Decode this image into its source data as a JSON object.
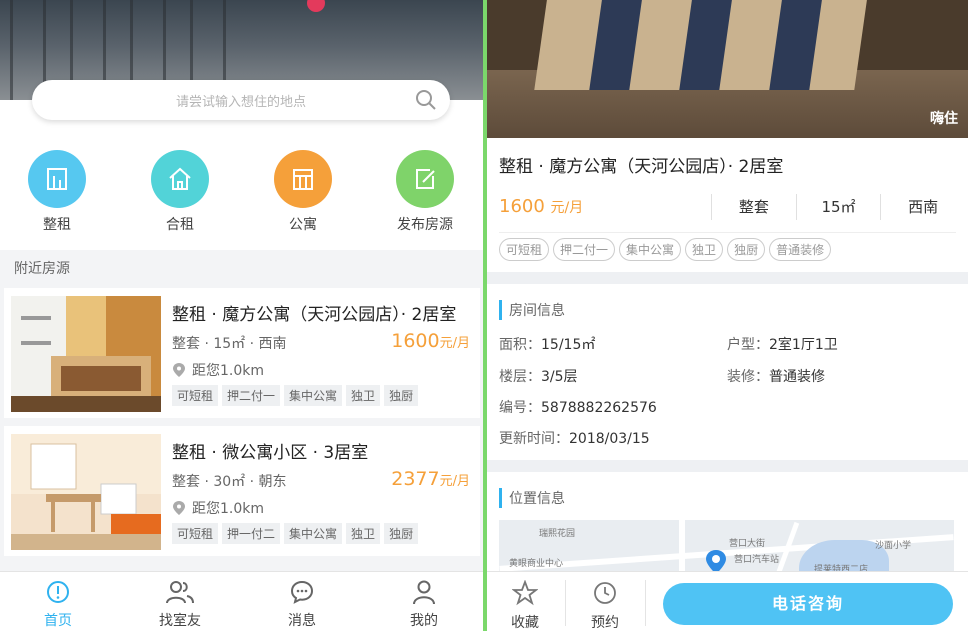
{
  "left": {
    "search": {
      "placeholder": "请尝试输入想住的地点"
    },
    "categories": [
      {
        "label": "整租",
        "icon": "building-icon",
        "color": "#56c8f0"
      },
      {
        "label": "合租",
        "icon": "house-icon",
        "color": "#52d3d8"
      },
      {
        "label": "公寓",
        "icon": "apartment-icon",
        "color": "#f5a03a"
      },
      {
        "label": "发布房源",
        "icon": "edit-icon",
        "color": "#7fd36a"
      }
    ],
    "nearby_title": "附近房源",
    "listings": [
      {
        "title": "整租 · 魔方公寓（天河公园店）· 2居室",
        "meta": "整套 · 15㎡ · 西南",
        "price": "1600",
        "unit": "元/月",
        "distance": "距您1.0km",
        "tags": [
          "可短租",
          "押二付一",
          "集中公寓",
          "独卫",
          "独厨"
        ]
      },
      {
        "title": "整租 · 微公寓小区 · 3居室",
        "meta": "整套 · 30㎡ · 朝东",
        "price": "2377",
        "unit": "元/月",
        "distance": "距您1.0km",
        "tags": [
          "可短租",
          "押一付二",
          "集中公寓",
          "独卫",
          "独厨"
        ]
      }
    ],
    "tabs": [
      {
        "label": "首页",
        "icon": "home-icon",
        "active": true
      },
      {
        "label": "找室友",
        "icon": "people-icon",
        "active": false
      },
      {
        "label": "消息",
        "icon": "message-icon",
        "active": false
      },
      {
        "label": "我的",
        "icon": "user-icon",
        "active": false
      }
    ]
  },
  "right": {
    "watermark": "嗨住",
    "title": "整租 · 魔方公寓（天河公园店）· 2居室",
    "price": "1600",
    "unit": "元/月",
    "attrs": [
      "整套",
      "15㎡",
      "西南"
    ],
    "tags": [
      "可短租",
      "押二付一",
      "集中公寓",
      "独卫",
      "独厨",
      "普通装修"
    ],
    "room_info": {
      "heading": "房间信息",
      "area_label": "面积：",
      "area": "15/15㎡",
      "layout_label": "户型：",
      "layout": "2室1厅1卫",
      "floor_label": "楼层：",
      "floor": "3/5层",
      "decor_label": "装修：",
      "decor": "普通装修",
      "id_label": "编号：",
      "id": "5878882262576",
      "updated_label": "更新时间：",
      "updated": "2018/03/15"
    },
    "location": {
      "heading": "位置信息",
      "map_labels": [
        "瑞熙花园",
        "营口大街",
        "黄眼商业中心",
        "营口汽车站",
        "沙面小学",
        "提莱特西二店"
      ]
    },
    "bottom": {
      "fav": "收藏",
      "book": "预约",
      "call": "电话咨询"
    }
  }
}
